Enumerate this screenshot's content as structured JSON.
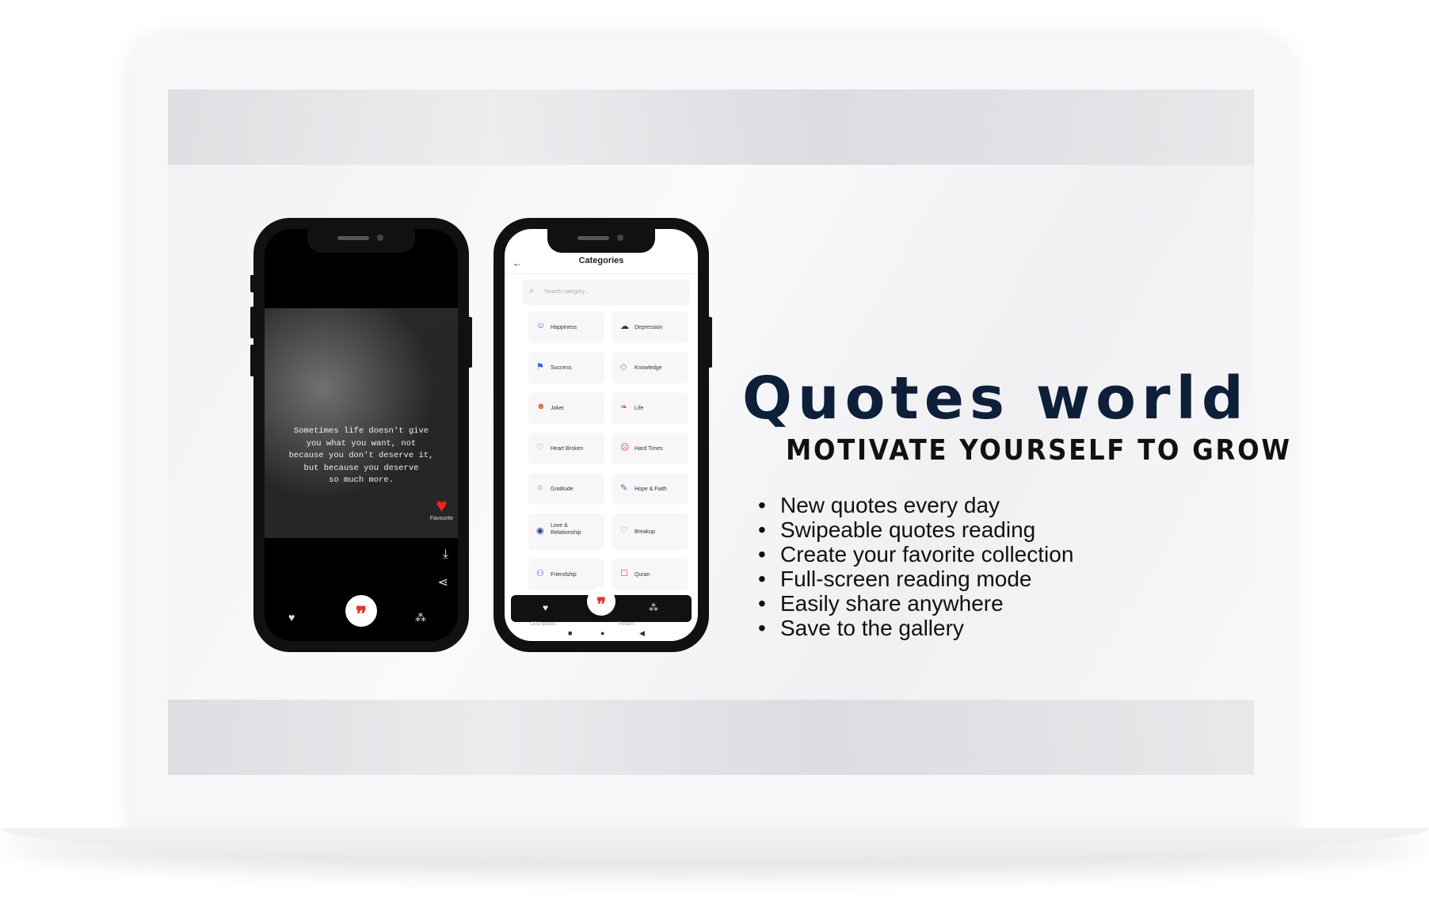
{
  "headline": "Quotes world",
  "tagline": "MOTIVATE YOURSELF TO GROW",
  "features": [
    "New quotes every day",
    "Swipeable quotes reading",
    "Create your favorite collection",
    "Full-screen reading mode",
    "Easily share anywhere",
    "Save to the gallery"
  ],
  "phone1": {
    "quote": "Sometimes life doesn't give\nyou what you want, not\nbecause you don't deserve it,\nbut because you deserve\nso much more.",
    "favourite_label": "Favourite",
    "icons": {
      "heart": "♥",
      "download": "⤓",
      "share": "⋖",
      "nav_left": "♥",
      "nav_center": "❞",
      "nav_right": "⁂"
    }
  },
  "phone2": {
    "title": "Categories",
    "back_icon": "←",
    "search_icon": "⌕",
    "search_placeholder": "Search category...",
    "categories": [
      {
        "label": "Happiness",
        "icon": "☺",
        "color": "#5a4fcf"
      },
      {
        "label": "Depression",
        "icon": "☁",
        "color": "#333333"
      },
      {
        "label": "Success",
        "icon": "⚑",
        "color": "#3a5bd9"
      },
      {
        "label": "Knowledge",
        "icon": "◇",
        "color": "#3aa0d9"
      },
      {
        "label": "Joker",
        "icon": "☻",
        "color": "#e0603a"
      },
      {
        "label": "Life",
        "icon": "❧",
        "color": "#e0603a"
      },
      {
        "label": "Heart Broken",
        "icon": "♡",
        "color": "#e0603a"
      },
      {
        "label": "Hard Times",
        "icon": "☹",
        "color": "#e03a6a"
      },
      {
        "label": "Gratitude",
        "icon": "☼",
        "color": "#3a8fd9"
      },
      {
        "label": "Hope & Faith",
        "icon": "✎",
        "color": "#5a4fcf"
      },
      {
        "label": "Love &\nRelationship",
        "icon": "◉",
        "color": "#2a3a8a"
      },
      {
        "label": "Breakup",
        "icon": "♡",
        "color": "#e0603a"
      },
      {
        "label": "Friendship",
        "icon": "⚇",
        "color": "#5a4fcf"
      },
      {
        "label": "Quran",
        "icon": "☐",
        "color": "#e03a6a"
      }
    ],
    "peek_left": "CEO quotes",
    "peek_right": "Posters",
    "nav": {
      "left": "♥",
      "center": "❞",
      "right": "⁂"
    },
    "sys_nav": {
      "left": "■",
      "center": "●",
      "right": "◀"
    }
  }
}
